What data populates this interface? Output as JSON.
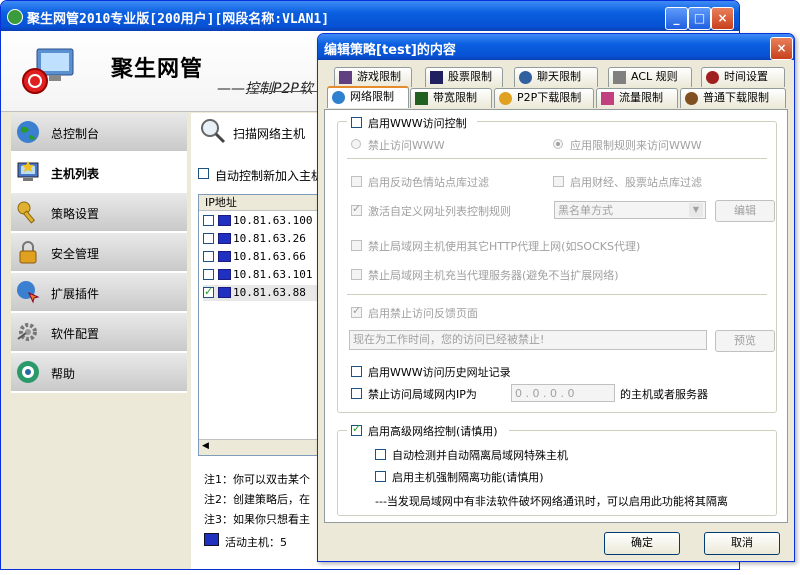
{
  "main_window": {
    "title": "聚生网管2010专业版[200用户][网段名称:VLAN1]",
    "brand_title": "聚生网管",
    "brand_subtitle": "——控制P2P软"
  },
  "sidebar": {
    "items": [
      {
        "label": "总控制台",
        "icon": "globe-icon"
      },
      {
        "label": "主机列表",
        "icon": "host-list-icon",
        "active": true
      },
      {
        "label": "策略设置",
        "icon": "key-icon"
      },
      {
        "label": "安全管理",
        "icon": "lock-icon"
      },
      {
        "label": "扩展插件",
        "icon": "plugin-icon"
      },
      {
        "label": "软件配置",
        "icon": "config-icon"
      },
      {
        "label": "帮助",
        "icon": "help-icon"
      }
    ]
  },
  "content": {
    "scan_label": "扫描网络主机",
    "auto_control_label": "自动控制新加入主机",
    "ip_header": "IP地址",
    "hosts": [
      {
        "ip": "10.81.63.100",
        "checked": false
      },
      {
        "ip": "10.81.63.26",
        "checked": false
      },
      {
        "ip": "10.81.63.66",
        "checked": false
      },
      {
        "ip": "10.81.63.101",
        "checked": false
      },
      {
        "ip": "10.81.63.88",
        "checked": true
      }
    ],
    "notes": [
      "注1：你可以双击某个",
      "注2：创建策略后，在",
      "注3：如果你只想看主"
    ],
    "active_hosts": "活动主机：5"
  },
  "dialog": {
    "title": "编辑策略[test]的内容",
    "tabs_row1": [
      "游戏限制",
      "股票限制",
      "聊天限制",
      "ACL 规则",
      "时间设置"
    ],
    "tabs_row2": [
      "网络限制",
      "带宽限制",
      "P2P下载限制",
      "流量限制",
      "普通下载限制"
    ],
    "active_tab": "网络限制",
    "www_control": "启用WWW访问控制",
    "ban_www": "禁止访问WWW",
    "apply_rules": "应用限制规则来访问WWW",
    "anti_porn": "启用反动色情站点库过滤",
    "finance_filter": "启用财经、股票站点库过滤",
    "custom_list": "激活自定义网址列表控制规则",
    "list_mode": "黑名单方式",
    "edit_btn": "编辑",
    "proxy_ban": "禁止局域网主机使用其它HTTP代理上网(如SOCKS代理)",
    "proxy_server_ban": "禁止局域网主机充当代理服务器(避免不当扩展网络)",
    "feedback": "启用禁止访问反馈页面",
    "feedback_text": "现在为工作时间，您的访问已经被禁止!",
    "preview_btn": "预览",
    "history": "启用WWW访问历史网址记录",
    "lan_ip_ban_prefix": "禁止访问局域网内IP为",
    "lan_ip_value": "0 . 0 . 0 . 0",
    "lan_ip_ban_suffix": "的主机或者服务器",
    "advanced": "启用高级网络控制(请慎用)",
    "auto_detect": "自动检测并自动隔离局域网特殊主机",
    "force_isolate": "启用主机强制隔离功能(请慎用)",
    "isolate_note": "---当发现局域网中有非法软件破坏网络通讯时，可以启用此功能将其隔离",
    "ok_btn": "确定",
    "cancel_btn": "取消"
  }
}
